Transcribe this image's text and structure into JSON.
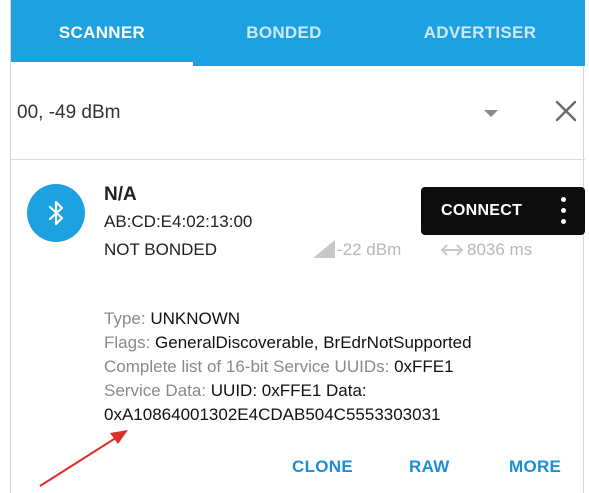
{
  "tabs": [
    {
      "label": "SCANNER",
      "active": true
    },
    {
      "label": "BONDED",
      "active": false
    },
    {
      "label": "ADVERTISER",
      "active": false
    }
  ],
  "filter": {
    "text": "00, -49 dBm"
  },
  "device": {
    "name": "N/A",
    "address": "AB:CD:E4:02:13:00",
    "bond_state": "NOT BONDED",
    "rssi": "-22 dBm",
    "interval": "8036 ms",
    "connect_label": "CONNECT",
    "details": {
      "type_label": "Type:",
      "type_value": "UNKNOWN",
      "flags_label": "Flags:",
      "flags_value": "GeneralDiscoverable, BrEdrNotSupported",
      "uuids_label": "Complete list of 16-bit Service UUIDs:",
      "uuids_value": "0xFFE1",
      "service_label": "Service Data:",
      "service_value_line1": "UUID: 0xFFE1 Data:",
      "service_value_line2": "0xA10864001302E4CDAB504C5553303031"
    },
    "actions": {
      "clone": "CLONE",
      "raw": "RAW",
      "more": "MORE"
    }
  },
  "colors": {
    "accent": "#1ea1e0",
    "action_text": "#1a8fd6",
    "connect_button": "#0d0d0d",
    "annotation_arrow": "#d9302a"
  },
  "icons": [
    "bluetooth-icon",
    "dropdown-arrow-icon",
    "close-icon",
    "signal-icon",
    "interval-arrows-icon",
    "more-vert-icon"
  ]
}
